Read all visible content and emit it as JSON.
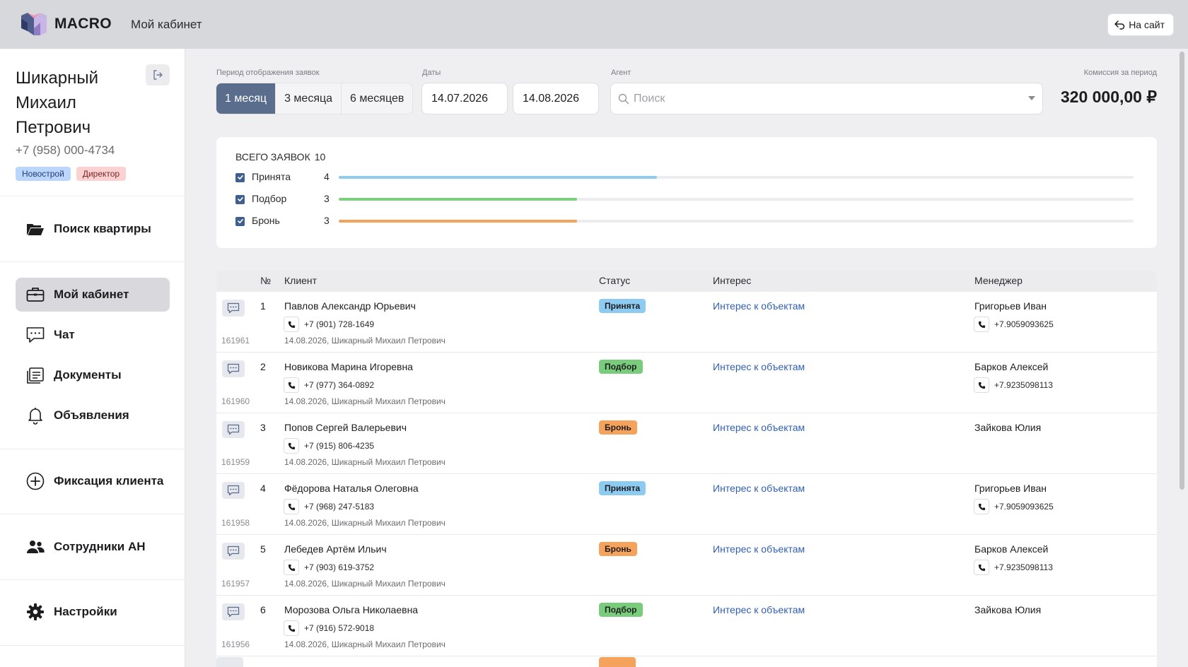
{
  "header": {
    "brand": "MACRO",
    "page_title": "Мой кабинет",
    "to_site": "На сайт"
  },
  "user": {
    "name": "Шикарный Михаил Петрович",
    "phone": "+7 (958) 000-4734",
    "badges": [
      "Новострой",
      "Директор"
    ]
  },
  "nav": {
    "search": "Поиск квартиры",
    "cabinet": "Мой кабинет",
    "chat": "Чат",
    "documents": "Документы",
    "ads": "Объявления",
    "fix_client": "Фиксация клиента",
    "staff": "Сотрудники АН",
    "settings": "Настройки"
  },
  "filters": {
    "period_label": "Период отображения заявок",
    "periods": [
      "1 месяц",
      "3 месяца",
      "6 месяцев"
    ],
    "dates_label": "Даты",
    "date_from": "14.07.2026",
    "date_to": "14.08.2026",
    "agent_label": "Агент",
    "agent_placeholder": "Поиск",
    "commission_label": "Комиссия за период",
    "commission_value": "320 000,00 ₽"
  },
  "summary": {
    "total_label": "ВСЕГО ЗАЯВОК",
    "total": "10",
    "max": 10,
    "rows": [
      {
        "label": "Принята",
        "count": "4",
        "value": 4,
        "color": "#8ecbf1"
      },
      {
        "label": "Подбор",
        "count": "3",
        "value": 3,
        "color": "#7bd07e"
      },
      {
        "label": "Бронь",
        "count": "3",
        "value": 3,
        "color": "#f5a35c"
      }
    ]
  },
  "table": {
    "headers": {
      "num": "№",
      "client": "Клиент",
      "status": "Статус",
      "interest": "Интерес",
      "manager": "Менеджер"
    },
    "rows": [
      {
        "id": "161961",
        "num": "1",
        "client": "Павлов Александр Юрьевич",
        "phone": "+7 (901) 728-1649",
        "meta": "14.08.2026, Шикарный Михаил Петрович",
        "status": "Принята",
        "interest": "Интерес к объектам",
        "manager": "Григорьев Иван",
        "manager_phone": "+7.9059093625"
      },
      {
        "id": "161960",
        "num": "2",
        "client": "Новикова Марина Игоревна",
        "phone": "+7 (977) 364-0892",
        "meta": "14.08.2026, Шикарный Михаил Петрович",
        "status": "Подбор",
        "interest": "Интерес к объектам",
        "manager": "Барков Алексей",
        "manager_phone": "+7.9235098113"
      },
      {
        "id": "161959",
        "num": "3",
        "client": "Попов Сергей Валерьевич",
        "phone": "+7 (915) 806-4235",
        "meta": "14.08.2026, Шикарный Михаил Петрович",
        "status": "Бронь",
        "interest": "Интерес к объектам",
        "manager": "Зайкова Юлия",
        "manager_phone": ""
      },
      {
        "id": "161958",
        "num": "4",
        "client": "Фёдорова Наталья Олеговна",
        "phone": "+7 (968) 247-5183",
        "meta": "14.08.2026, Шикарный Михаил Петрович",
        "status": "Принята",
        "interest": "Интерес к объектам",
        "manager": "Григорьев Иван",
        "manager_phone": "+7.9059093625"
      },
      {
        "id": "161957",
        "num": "5",
        "client": "Лебедев Артём Ильич",
        "phone": "+7 (903) 619-3752",
        "meta": "14.08.2026, Шикарный Михаил Петрович",
        "status": "Бронь",
        "interest": "Интерес к объектам",
        "manager": "Барков Алексей",
        "manager_phone": "+7.9235098113"
      },
      {
        "id": "161956",
        "num": "6",
        "client": "Морозова Ольга Николаевна",
        "phone": "+7 (916) 572-9018",
        "meta": "14.08.2026, Шикарный Михаил Петрович",
        "status": "Подбор",
        "interest": "Интерес к объектам",
        "manager": "Зайкова Юлия",
        "manager_phone": ""
      }
    ]
  }
}
